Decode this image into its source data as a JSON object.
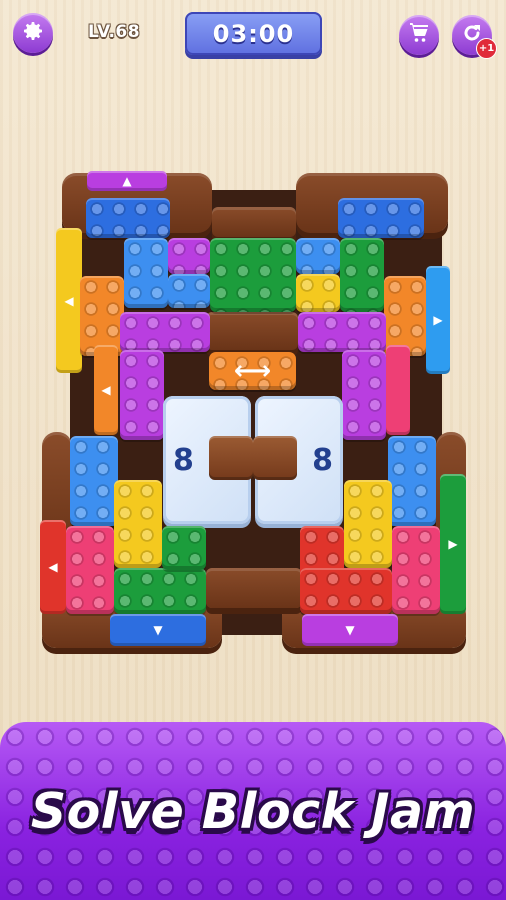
{
  "hud": {
    "level_label": "LV.68",
    "timer": "03:00",
    "undo_badge": "+1",
    "icons": [
      "gear-icon",
      "cart-icon",
      "refresh-icon"
    ]
  },
  "board": {
    "ice_left_count": "8",
    "ice_right_count": "8",
    "slider_arrow": "⟷",
    "exit_arrows": {
      "top": "▲",
      "left_upper": "◀",
      "left_mid": "◀",
      "right_upper": "▶",
      "left_lower": "◀",
      "right_lower": "▶",
      "bottom_left": "▼",
      "bottom_right": "▼"
    },
    "colors": {
      "blue": "#2d6ee0",
      "purple": "#b93ee0",
      "green": "#1c9d3c",
      "orange": "#f28729",
      "yellow": "#f4c91f",
      "red": "#e0342b",
      "pink": "#ee3f75",
      "wood": "#7a4020"
    }
  },
  "banner": {
    "title": "Solve Block Jam"
  }
}
